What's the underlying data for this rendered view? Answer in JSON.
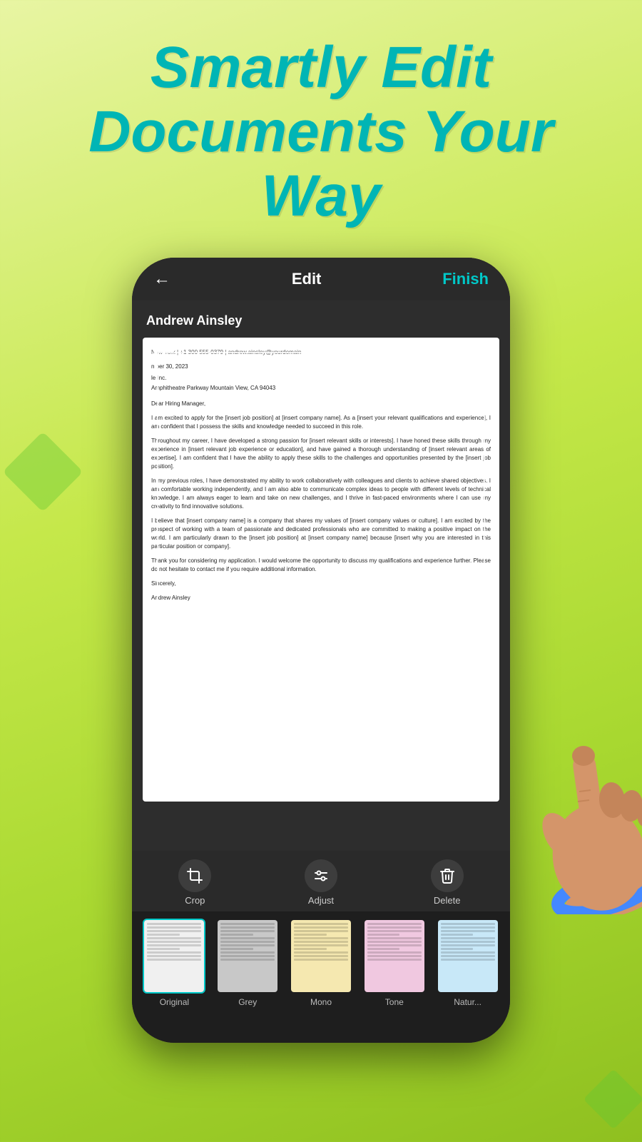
{
  "header": {
    "title_line1": "Smartly Edit",
    "title_line2": "Documents Your Way"
  },
  "phone": {
    "topbar": {
      "back_label": "←",
      "title": "Edit",
      "finish_label": "Finish"
    },
    "document": {
      "name": "Andrew Ainsley",
      "contact": "New York | +1 300 555-0379 | andrew.ainsley@yourdomain",
      "date": "mber 30, 2023",
      "company_line1": "le Inc.",
      "company_line2": "Amphitheatre Parkway Mountain View, CA 94043",
      "salutation": "Dear Hiring Manager,",
      "paragraph1": "I am excited to apply for the [insert job position] at [insert company name]. As a [insert your relevant qualifications and experience], I am confident that I possess the skills and knowledge needed to succeed in this role.",
      "paragraph2": "Throughout my career, I have developed a strong passion for [insert relevant skills or interests]. I have honed these skills through my experience in [insert relevant job experience or education], and have gained a thorough understanding of [insert relevant areas of expertise]. I am confident that I have the ability to apply these skills to the challenges and opportunities presented by the [insert job position].",
      "paragraph3": "In my previous roles, I have demonstrated my ability to work collaboratively with colleagues and clients to achieve shared objectives. I am comfortable working independently, and I am also able to communicate complex ideas to people with different levels of technical knowledge. I am always eager to learn and take on new challenges, and I thrive in fast-paced environments where I can use my creativity to find innovative solutions.",
      "paragraph4": "I believe that [insert company name] is a company that shares my values of [insert company values or culture]. I am excited by the prospect of working with a team of passionate and dedicated professionals who are committed to making a positive impact on the world. I am particularly drawn to the [insert job position] at [insert company name] because [insert why you are interested in this particular position or company].",
      "paragraph5": "Thank you for considering my application. I would welcome the opportunity to discuss my qualifications and experience further. Please do not hesitate to contact me if you require additional information.",
      "closing": "Sincerely,",
      "signature": "Andrew Ainsley"
    },
    "toolbar": {
      "crop_label": "Crop",
      "adjust_label": "Adjust",
      "delete_label": "Delete"
    },
    "filters": [
      {
        "id": "original",
        "label": "Original",
        "selected": true,
        "style": "original"
      },
      {
        "id": "grey",
        "label": "Grey",
        "selected": false,
        "style": "grey"
      },
      {
        "id": "mono",
        "label": "Mono",
        "selected": false,
        "style": "mono"
      },
      {
        "id": "tone",
        "label": "Tone",
        "selected": false,
        "style": "tone"
      },
      {
        "id": "nature",
        "label": "Natur...",
        "selected": false,
        "style": "nature"
      }
    ]
  },
  "colors": {
    "accent": "#00c8c8",
    "bg_gradient_start": "#e8f5a3",
    "bg_gradient_end": "#8fc020",
    "title_color": "#00b5b5"
  }
}
